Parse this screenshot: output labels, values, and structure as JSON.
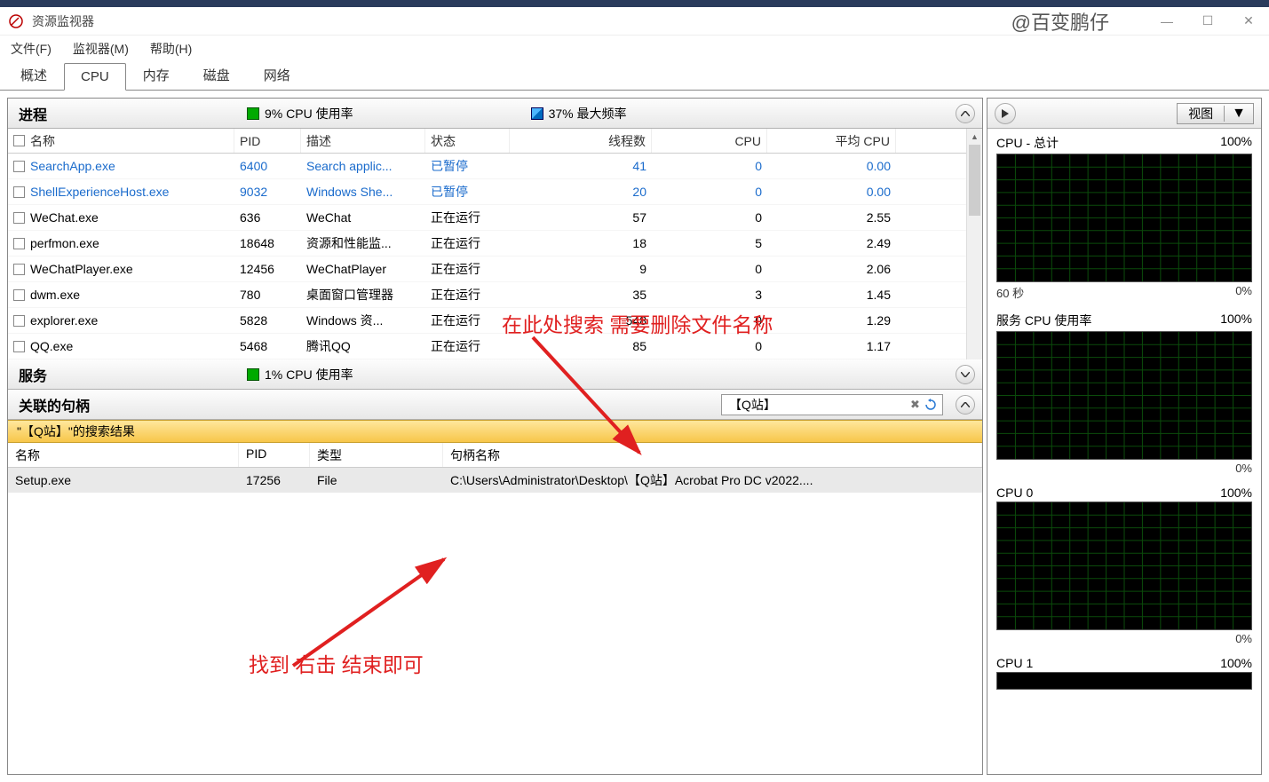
{
  "window": {
    "title": "资源监视器",
    "watermark": "@百变鹏仔"
  },
  "menu": {
    "file": "文件(F)",
    "monitor": "监视器(M)",
    "help": "帮助(H)"
  },
  "tabs": {
    "overview": "概述",
    "cpu": "CPU",
    "memory": "内存",
    "disk": "磁盘",
    "network": "网络"
  },
  "sections": {
    "processes": {
      "title": "进程",
      "cpu_usage": "9% CPU 使用率",
      "max_freq": "37% 最大频率"
    },
    "services": {
      "title": "服务",
      "cpu_usage": "1% CPU 使用率"
    },
    "handles": {
      "title": "关联的句柄"
    }
  },
  "columns": {
    "name": "名称",
    "pid": "PID",
    "desc": "描述",
    "status": "状态",
    "threads": "线程数",
    "cpu": "CPU",
    "avgcpu": "平均 CPU",
    "handle_type": "类型",
    "handle_name": "句柄名称"
  },
  "processes": [
    {
      "name": "SearchApp.exe",
      "pid": "6400",
      "desc": "Search applic...",
      "status": "已暂停",
      "threads": "41",
      "cpu": "0",
      "avgcpu": "0.00",
      "suspended": true
    },
    {
      "name": "ShellExperienceHost.exe",
      "pid": "9032",
      "desc": "Windows She...",
      "status": "已暂停",
      "threads": "20",
      "cpu": "0",
      "avgcpu": "0.00",
      "suspended": true
    },
    {
      "name": "WeChat.exe",
      "pid": "636",
      "desc": "WeChat",
      "status": "正在运行",
      "threads": "57",
      "cpu": "0",
      "avgcpu": "2.55",
      "suspended": false
    },
    {
      "name": "perfmon.exe",
      "pid": "18648",
      "desc": "资源和性能监...",
      "status": "正在运行",
      "threads": "18",
      "cpu": "5",
      "avgcpu": "2.49",
      "suspended": false
    },
    {
      "name": "WeChatPlayer.exe",
      "pid": "12456",
      "desc": "WeChatPlayer",
      "status": "正在运行",
      "threads": "9",
      "cpu": "0",
      "avgcpu": "2.06",
      "suspended": false
    },
    {
      "name": "dwm.exe",
      "pid": "780",
      "desc": "桌面窗口管理器",
      "status": "正在运行",
      "threads": "35",
      "cpu": "3",
      "avgcpu": "1.45",
      "suspended": false
    },
    {
      "name": "explorer.exe",
      "pid": "5828",
      "desc": "Windows 资...",
      "status": "正在运行",
      "threads": "548",
      "cpu": "0",
      "avgcpu": "1.29",
      "suspended": false
    },
    {
      "name": "QQ.exe",
      "pid": "5468",
      "desc": "腾讯QQ",
      "status": "正在运行",
      "threads": "85",
      "cpu": "0",
      "avgcpu": "1.17",
      "suspended": false
    }
  ],
  "search": {
    "value": "【Q站】",
    "results_label": "\"【Q站】\"的搜索结果"
  },
  "handle_results": [
    {
      "name": "Setup.exe",
      "pid": "17256",
      "type": "File",
      "hname": "C:\\Users\\Administrator\\Desktop\\【Q站】Acrobat Pro DC v2022...."
    }
  ],
  "right_panel": {
    "view_label": "视图",
    "charts": [
      {
        "title": "CPU - 总计",
        "right": "100%",
        "sub_left": "60 秒",
        "sub_right": "0%"
      },
      {
        "title": "服务 CPU 使用率",
        "right": "100%",
        "sub_left": "",
        "sub_right": "0%"
      },
      {
        "title": "CPU 0",
        "right": "100%",
        "sub_left": "",
        "sub_right": "0%"
      },
      {
        "title": "CPU 1",
        "right": "100%",
        "sub_left": "",
        "sub_right": ""
      }
    ]
  },
  "annotations": {
    "top": "在此处搜索 需要删除文件名称",
    "bottom": "找到 右击 结束即可"
  }
}
